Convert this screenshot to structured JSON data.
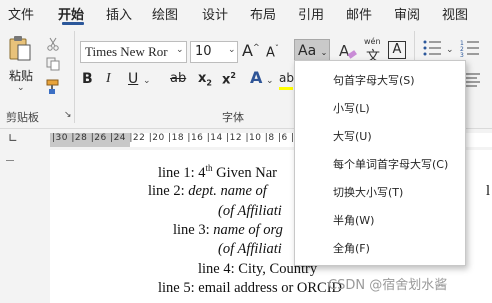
{
  "menubar": {
    "tabs": [
      "文件",
      "开始",
      "插入",
      "绘图",
      "设计",
      "布局",
      "引用",
      "邮件",
      "审阅",
      "视图"
    ],
    "active_tab": "开始"
  },
  "ribbon": {
    "clipboard": {
      "paste_label": "粘贴",
      "group_label": "剪贴板"
    },
    "font": {
      "font_name": "Times New Ror",
      "font_size": "10",
      "grow_label": "A",
      "shrink_label": "A",
      "change_case_label": "Aa",
      "phonetic_label": "wén",
      "bold_label": "B",
      "italic_label": "I",
      "underline_label": "U",
      "strike_label": "ab",
      "subscript_label": "x",
      "superscript_label": "x",
      "text_effect_label": "A",
      "highlight_label": "ab",
      "font_color_label": "A",
      "group_label": "字体"
    }
  },
  "ruler": {
    "text": "|30 |28 |26 |24 |22 |20 |18 |16 |14 |12 |10 |8 |6 |4 |2"
  },
  "document": {
    "line1_prefix": "line 1: 4",
    "line1_sup": "th",
    "line1_suffix": " Given Nar",
    "line2_prefix": "line 2: ",
    "line2_italic": "dept. name of",
    "line2b_italic": "(of Affiliati",
    "line3_prefix": "line 3: ",
    "line3_italic": "name of org",
    "line3b_italic": "(of Affiliati",
    "line4": "line 4: City, Country",
    "line5": "line 5: email address  or ORCID",
    "right_char": "l"
  },
  "dropdown": {
    "items": [
      "句首字母大写(S)",
      "小写(L)",
      "大写(U)",
      "每个单词首字母大写(C)",
      "切换大小写(T)",
      "半角(W)",
      "全角(F)"
    ]
  },
  "watermark": "CSDN @宿舍划水酱",
  "colors": {
    "accent": "#2b579a",
    "bold_icon": "#1f1f1f",
    "text_effect": "#2f5597",
    "font_color_bar": "#ff0000",
    "highlight_bar": "#ffff00"
  }
}
